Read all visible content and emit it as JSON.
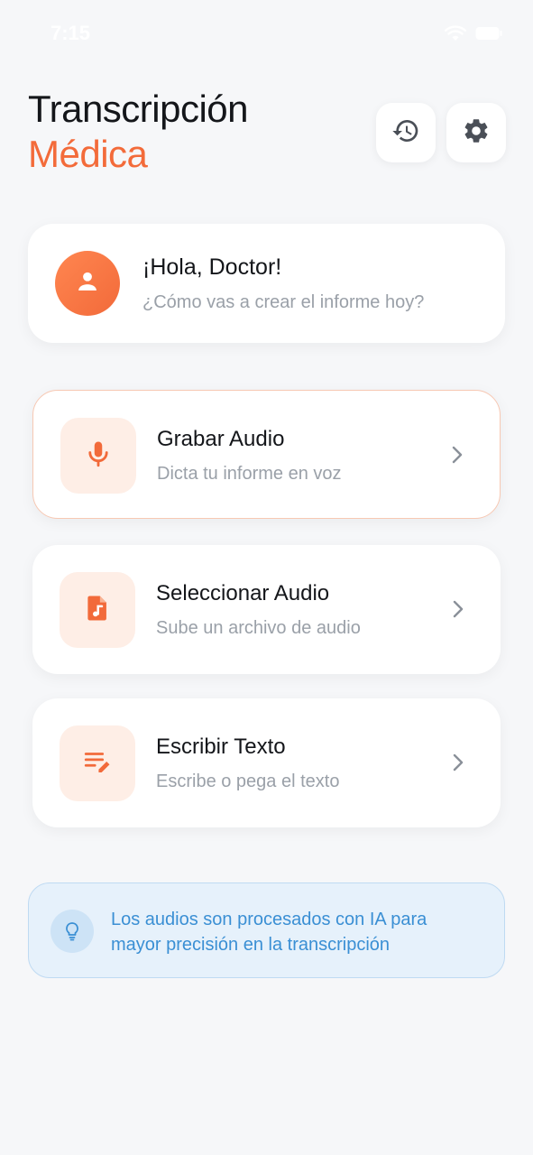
{
  "status_bar": {
    "time": "7:15"
  },
  "header": {
    "title_line1": "Transcripción",
    "title_line2": "Médica",
    "accent_color": "#f36b3a",
    "actions": [
      {
        "icon": "history-icon"
      },
      {
        "icon": "gear-icon"
      }
    ]
  },
  "greeting": {
    "avatar_icon": "user-icon",
    "title": "¡Hola, Doctor!",
    "subtitle": "¿Cómo vas a crear el informe hoy?"
  },
  "options": [
    {
      "icon": "microphone-icon",
      "title": "Grabar Audio",
      "subtitle": "Dicta tu informe en voz",
      "active": true
    },
    {
      "icon": "audio-file-icon",
      "title": "Seleccionar Audio",
      "subtitle": "Sube un archivo de audio",
      "active": false
    },
    {
      "icon": "edit-text-icon",
      "title": "Escribir Texto",
      "subtitle": "Escribe o pega el texto",
      "active": false
    }
  ],
  "info": {
    "icon": "lightbulb-icon",
    "text": "Los audios son procesados con IA para mayor precisión en la transcripción",
    "color": "#3a8fd4"
  }
}
